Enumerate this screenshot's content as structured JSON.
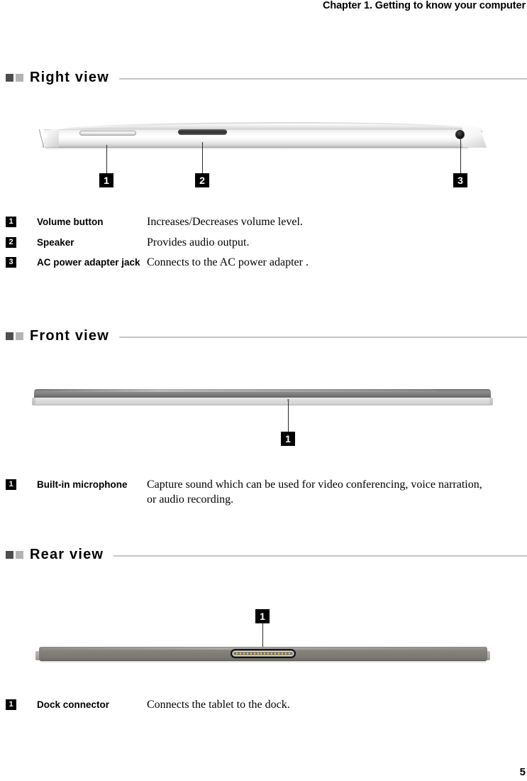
{
  "header": {
    "chapter_title": "Chapter 1. Getting to know your computer"
  },
  "sections": [
    {
      "title": "Right view",
      "callouts": [
        {
          "number": "1"
        },
        {
          "number": "2"
        },
        {
          "number": "3"
        }
      ],
      "items": [
        {
          "number": "1",
          "term": "Volume button",
          "description": "Increases/Decreases volume level."
        },
        {
          "number": "2",
          "term": "Speaker",
          "description": "Provides audio output."
        },
        {
          "number": "3",
          "term": "AC power adapter jack",
          "description": "Connects to the AC power adapter ."
        }
      ]
    },
    {
      "title": "Front view",
      "callouts": [
        {
          "number": "1"
        }
      ],
      "items": [
        {
          "number": "1",
          "term": "Built-in microphone",
          "description": "Capture sound which can be used for video conferencing, voice narration, or audio recording."
        }
      ]
    },
    {
      "title": "Rear view",
      "callouts": [
        {
          "number": "1"
        }
      ],
      "items": [
        {
          "number": "1",
          "term": "Dock connector",
          "description": "Connects the tablet to the dock."
        }
      ]
    }
  ],
  "footer": {
    "page_number": "5"
  },
  "colors": {
    "marker_dark": "#4d4d4d",
    "marker_light": "#b3b3b3",
    "rule": "#c6c6c6",
    "badge_bg": "#000000",
    "dock_pin": "#e0b84a"
  }
}
